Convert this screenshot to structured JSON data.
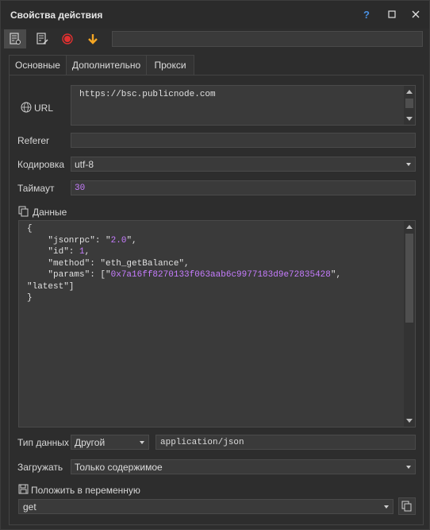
{
  "window": {
    "title": "Свойства действия",
    "help": "?",
    "maximize": "□",
    "close": "×"
  },
  "toolbar": {
    "field_value": ""
  },
  "tabs": [
    {
      "label": "Основные"
    },
    {
      "label": "Дополнительно"
    },
    {
      "label": "Прокси"
    }
  ],
  "form": {
    "url_label": "URL",
    "url_value": "https://bsc.publicnode.com",
    "referer_label": "Referer",
    "referer_value": "",
    "encoding_label": "Кодировка",
    "encoding_value": "utf-8",
    "timeout_label": "Таймаут",
    "timeout_value": "30",
    "data_label": "Данные",
    "data_lines": {
      "l1": "{",
      "l2a": "    \"jsonrpc\": \"",
      "l2b": "2.0",
      "l2c": "\",",
      "l3a": "    \"id\": ",
      "l3b": "1",
      "l3c": ",",
      "l4": "    \"method\": \"eth_getBalance\",",
      "l5a": "    \"params\": [\"",
      "l5b": "0x7a16ff8270133f063aab6c9977183d9e72835428",
      "l5c": "\",",
      "l6": "\"latest\"]",
      "l7": "}"
    },
    "datatype_label": "Тип данных",
    "datatype_value": "Другой",
    "content_type_value": "application/json",
    "load_label": "Загружать",
    "load_value": "Только содержимое",
    "save_to_var_label": "Положить в переменную",
    "var_value": "get"
  },
  "colors": {
    "accent_purple": "#c77dff",
    "record_red": "#e03030",
    "arrow_orange": "#f5a623",
    "help_blue": "#4a90e2"
  }
}
